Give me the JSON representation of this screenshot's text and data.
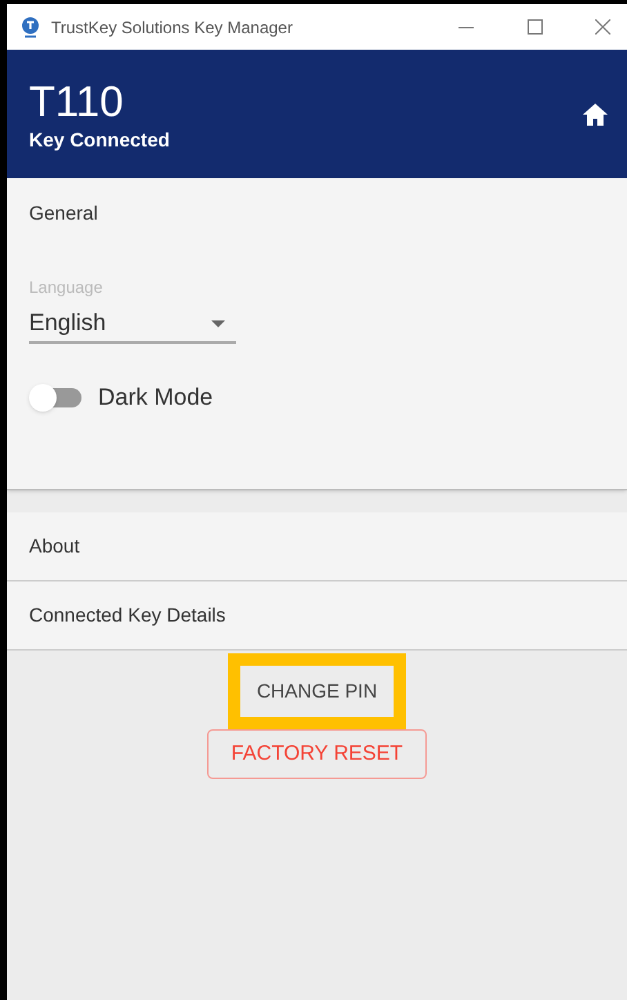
{
  "window": {
    "title": "TrustKey Solutions Key Manager"
  },
  "header": {
    "title": "T110",
    "subtitle": "Key Connected"
  },
  "general": {
    "heading": "General",
    "language": {
      "label": "Language",
      "value": "English"
    },
    "dark_mode": {
      "label": "Dark Mode",
      "on": false
    }
  },
  "sections": [
    {
      "label": "About"
    },
    {
      "label": "Connected Key Details"
    }
  ],
  "buttons": [
    {
      "label": "CHANGE PIN",
      "kind": "default",
      "highlighted": true
    },
    {
      "label": "FACTORY RESET",
      "kind": "danger",
      "highlighted": false
    }
  ]
}
